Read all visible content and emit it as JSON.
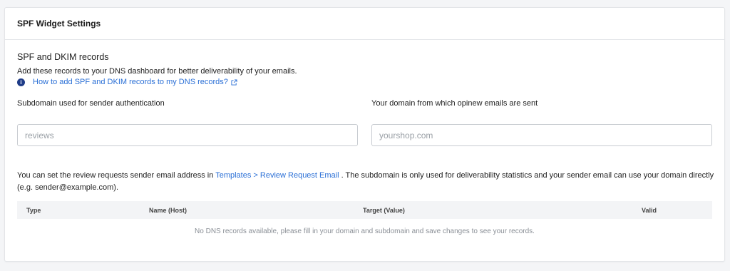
{
  "card": {
    "title": "SPF Widget Settings"
  },
  "section": {
    "title": "SPF and DKIM records",
    "description": "Add these records to your DNS dashboard for better deliverability of your emails.",
    "help_link": "How to add SPF and DKIM records to my DNS records?",
    "info_icon_glyph": "i"
  },
  "fields": {
    "subdomain_label": "Subdomain used for sender authentication",
    "subdomain_placeholder": "reviews",
    "subdomain_value": "",
    "domain_label": "Your domain from which opinew emails are sent",
    "domain_placeholder": "yourshop.com",
    "domain_value": ""
  },
  "note": {
    "prefix": "You can set the review requests sender email address in ",
    "link": "Templates > Review Request Email",
    "suffix": " . The subdomain is only used for deliverability statistics and your sender email can use your domain directly (e.g. sender@example.com)."
  },
  "table": {
    "columns": [
      "Type",
      "Name (Host)",
      "Target (Value)",
      "Valid"
    ],
    "empty_message": "No DNS records available, please fill in your domain and subdomain and save changes to see your records."
  },
  "icons": {
    "info": "info-icon",
    "external_link": "external-link-icon"
  },
  "colors": {
    "link": "#2a6fd6",
    "info_icon": "#1f3c88"
  }
}
